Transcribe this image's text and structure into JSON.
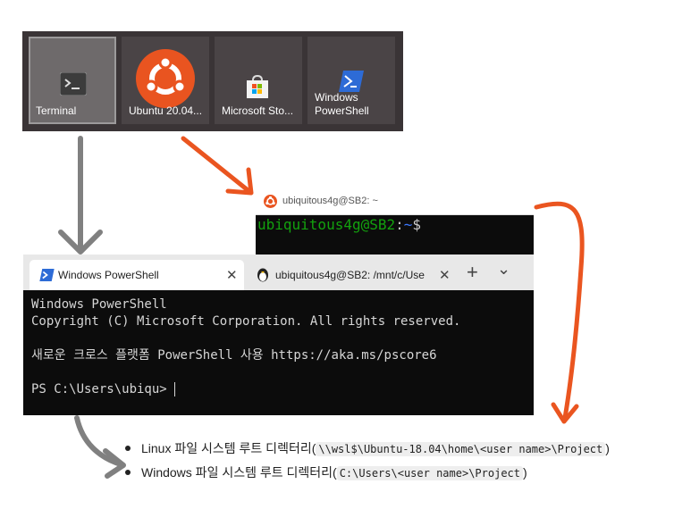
{
  "tiles": [
    {
      "label": "Terminal",
      "icon": "terminal-icon",
      "selected": true
    },
    {
      "label": "Ubuntu 20.04...",
      "icon": "ubuntu-icon",
      "selected": false
    },
    {
      "label": "Microsoft Sto...",
      "icon": "store-icon",
      "selected": false
    },
    {
      "label": "Windows\nPowerShell",
      "icon": "powershell-icon",
      "selected": false
    }
  ],
  "ubuntu_window": {
    "title": "ubiquitous4g@SB2: ~",
    "prompt_user": "ubiquitous4g@SB2",
    "prompt_sep": ":",
    "prompt_path": "~",
    "prompt_symbol": "$"
  },
  "terminal": {
    "tabs": [
      {
        "label": "Windows PowerShell",
        "icon": "powershell-icon",
        "active": true
      },
      {
        "label": "ubiquitous4g@SB2: /mnt/c/Use",
        "icon": "linux-icon",
        "active": false
      }
    ],
    "new_tab": "+",
    "dropdown": "⌄",
    "lines": [
      "Windows PowerShell",
      "Copyright (C) Microsoft Corporation. All rights reserved.",
      "",
      "새로운 크로스 플랫폼 PowerShell 사용 https://aka.ms/pscore6",
      "",
      "PS C:\\Users\\ubiqu> "
    ]
  },
  "bullets": [
    {
      "text": "Linux 파일 시스템 루트 디렉터리(",
      "code": "\\\\wsl$\\Ubuntu-18.04\\home\\<user name>\\Project",
      "close": ")"
    },
    {
      "text": "Windows 파일 시스템 루트 디렉터리(",
      "code": "C:\\Users\\<user name>\\Project",
      "close": ")"
    }
  ],
  "colors": {
    "arrow_gray": "#808080",
    "arrow_orange": "#ea5520",
    "ubuntu": "#e95420",
    "ps_blue": "#2d6bd6"
  }
}
